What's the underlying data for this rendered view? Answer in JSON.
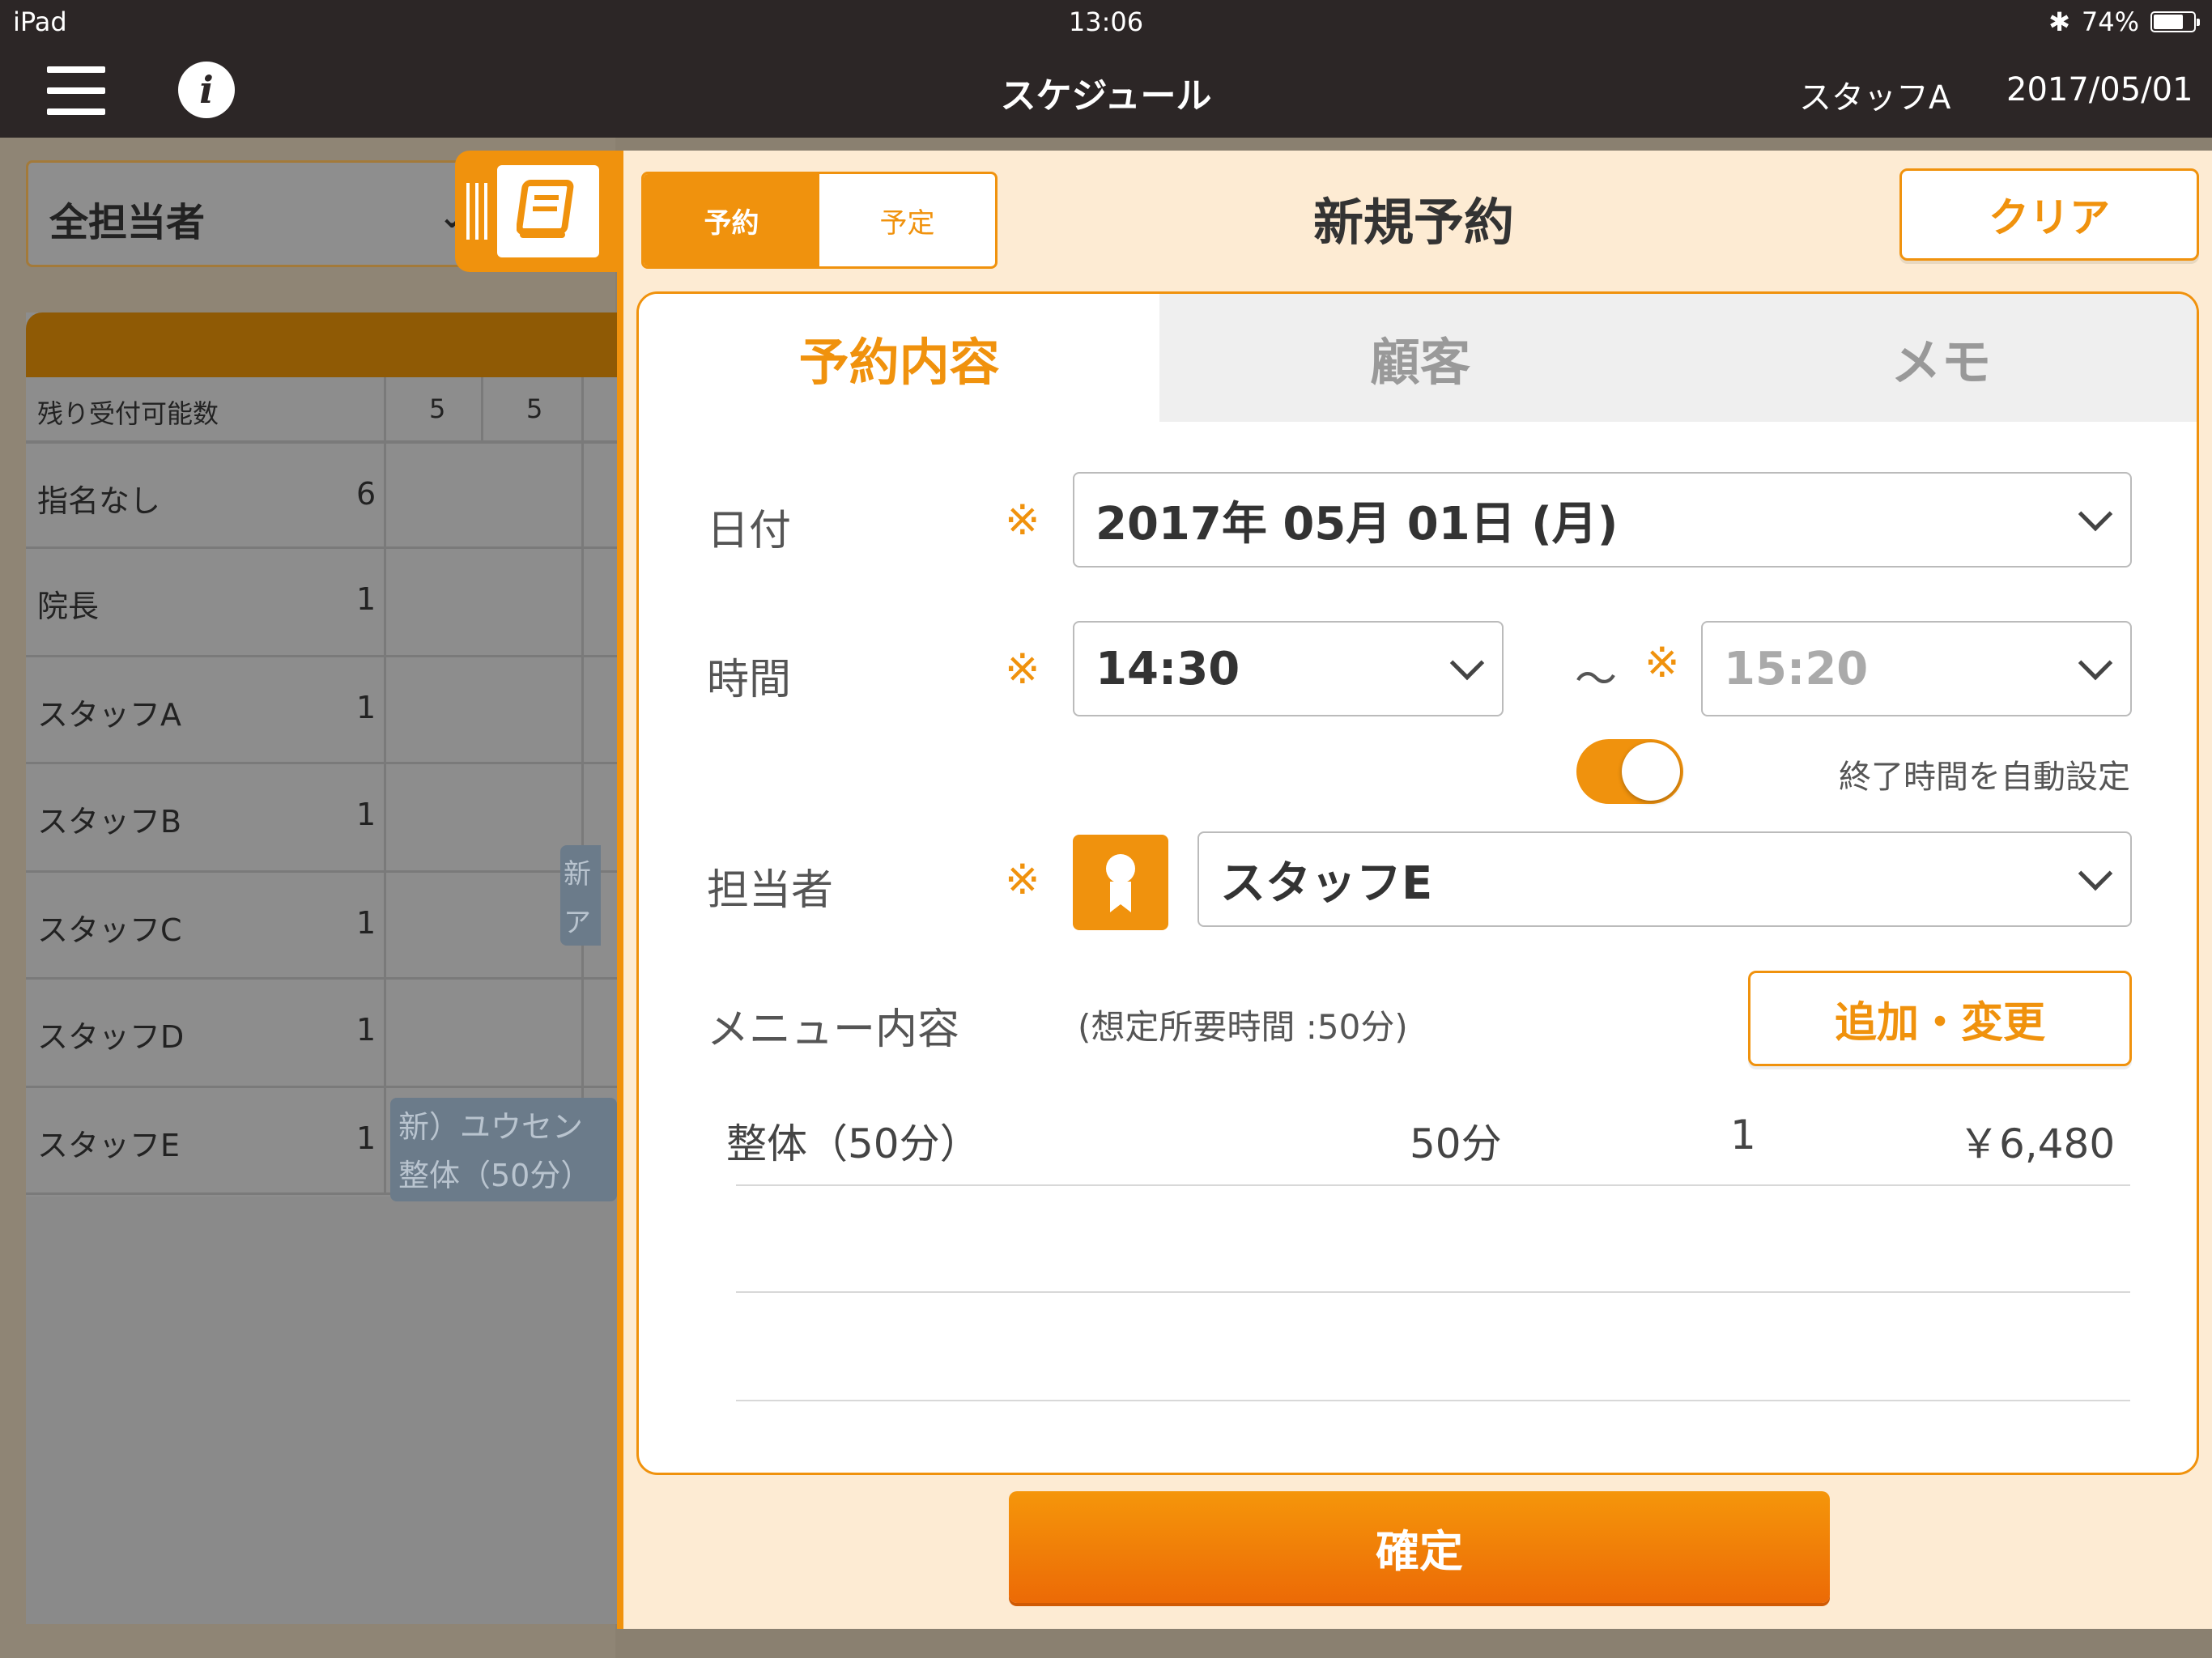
{
  "status_bar": {
    "device": "iPad",
    "time": "13:06",
    "battery_percent": "74%",
    "battery_level": 0.74
  },
  "nav": {
    "title": "スケジュール",
    "staff": "スタッフA",
    "date": "2017/05/01"
  },
  "schedule": {
    "staff_filter": "全担当者",
    "remaining_label": "残り受付可能数",
    "remaining_values": [
      "5",
      "5"
    ],
    "rows": [
      {
        "name": "指名なし",
        "count": "6"
      },
      {
        "name": "院長",
        "count": "1"
      },
      {
        "name": "スタッフA",
        "count": "1"
      },
      {
        "name": "スタッフB",
        "count": "1"
      },
      {
        "name": "スタッフC",
        "count": "1"
      },
      {
        "name": "スタッフD",
        "count": "1"
      },
      {
        "name": "スタッフE",
        "count": "1"
      }
    ],
    "appointment_c": {
      "line1": "新",
      "line2": "ア"
    },
    "appointment_e": {
      "line1": "新）ユウセン",
      "line2": "整体（50分）"
    }
  },
  "panel": {
    "segment": {
      "reserve": "予約",
      "plan": "予定"
    },
    "title": "新規予約",
    "clear": "クリア",
    "tabs": [
      "予約内容",
      "顧客",
      "メモ"
    ],
    "required_mark": "※",
    "date": {
      "label": "日付",
      "value": "2017年 05月 01日 (月)"
    },
    "time": {
      "label": "時間",
      "start": "14:30",
      "separator": "〜",
      "end": "15:20"
    },
    "auto_end": {
      "label": "終了時間を自動設定",
      "on": true
    },
    "staff": {
      "label": "担当者",
      "value": "スタッフE"
    },
    "menu": {
      "label": "メニュー内容",
      "note": "(想定所要時間 :50分)",
      "add_button": "追加・変更",
      "items": [
        {
          "name": "整体（50分）",
          "duration": "50分",
          "qty": "1",
          "price": "￥6,480"
        }
      ]
    },
    "confirm": "確定"
  }
}
